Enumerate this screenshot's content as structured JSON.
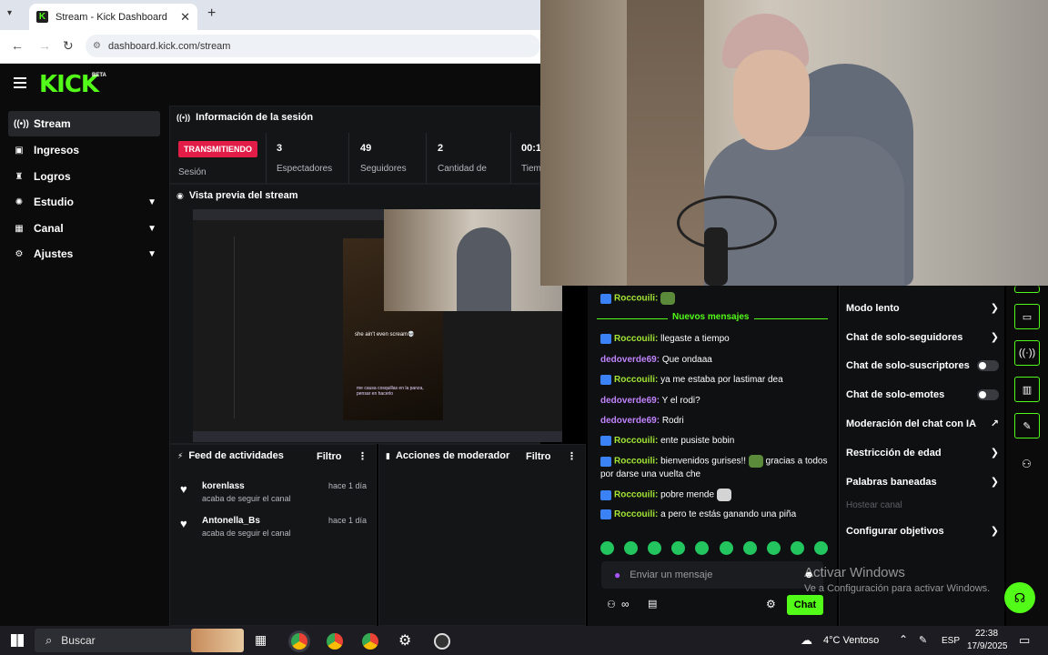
{
  "browser": {
    "tab_title": "Stream - Kick Dashboard",
    "url": "dashboard.kick.com/stream"
  },
  "brand": {
    "logo": "KICK",
    "beta": "BETA",
    "accent": "#53fc18"
  },
  "sidebar": {
    "items": [
      {
        "label": "Stream",
        "icon": "broadcast-icon",
        "active": true
      },
      {
        "label": "Ingresos",
        "icon": "wallet-icon"
      },
      {
        "label": "Logros",
        "icon": "trophy-icon"
      },
      {
        "label": "Estudio",
        "icon": "studio-icon"
      },
      {
        "label": "Canal",
        "icon": "channel-icon"
      },
      {
        "label": "Ajustes",
        "icon": "gear-icon"
      }
    ]
  },
  "session": {
    "title": "Información de la sesión",
    "live_badge": "TRANSMITIENDO",
    "status_label": "Sesión",
    "stats": [
      {
        "value": "3",
        "label": "Espectadores"
      },
      {
        "value": "49",
        "label": "Seguidores"
      },
      {
        "value": "2",
        "label": "Cantidad de"
      },
      {
        "value": "00:1",
        "label": "Tiem"
      }
    ]
  },
  "preview": {
    "title": "Vista previa del stream",
    "caption": "she ain't even scream💀",
    "caption2": "me causa cosquillas en la panza, pensar en hacerlo"
  },
  "activity": {
    "title": "Feed de actividades",
    "filter": "Filtro",
    "items": [
      {
        "name": "korenlass",
        "sub": "acaba de seguir el canal",
        "time": "hace 1 día"
      },
      {
        "name": "Antonella_Bs",
        "sub": "acaba de seguir el canal",
        "time": "hace 1 día"
      }
    ]
  },
  "moderator": {
    "title": "Acciones de moderador",
    "filter": "Filtro"
  },
  "chat": {
    "new_messages": "Nuevos mensajes",
    "messages": [
      {
        "user": "Roccouili:",
        "text": "",
        "kind": "rocco"
      },
      {
        "user": "Roccouili:",
        "text": "llegaste a tiempo",
        "kind": "rocco"
      },
      {
        "user": "dedoverde69:",
        "text": "Que ondaaa",
        "kind": "dedo"
      },
      {
        "user": "Roccouili:",
        "text": "ya me estaba por lastimar dea",
        "kind": "rocco"
      },
      {
        "user": "dedoverde69:",
        "text": "Y el rodi?",
        "kind": "dedo"
      },
      {
        "user": "dedoverde69:",
        "text": "Rodri",
        "kind": "dedo"
      },
      {
        "user": "Roccouili:",
        "text": "ente pusiste bobin",
        "kind": "rocco"
      },
      {
        "user": "Roccouili:",
        "text": "bienvenidos gurises!!",
        "text2": "gracias a todos por darse una vuelta che",
        "kind": "rocco"
      },
      {
        "user": "Roccouili:",
        "text": "pobre mende",
        "kind": "rocco"
      },
      {
        "user": "Roccouili:",
        "text": "a pero te estás ganando una piña",
        "kind": "rocco"
      }
    ],
    "input_placeholder": "Enviar un mensaje",
    "send_label": "Chat"
  },
  "settings": {
    "items": [
      {
        "label": "Modo lento",
        "control": "arrow"
      },
      {
        "label": "Chat de solo-seguidores",
        "control": "arrow"
      },
      {
        "label": "Chat de solo-suscriptores",
        "control": "toggle"
      },
      {
        "label": "Chat de solo-emotes",
        "control": "toggle"
      },
      {
        "label": "Moderación del chat con IA",
        "control": "external"
      },
      {
        "label": "Restricción de edad",
        "control": "arrow"
      },
      {
        "label": "Palabras baneadas",
        "control": "arrow"
      },
      {
        "label": "Hostear canal",
        "control": "disabled"
      },
      {
        "label": "Configurar objetivos",
        "control": "arrow"
      }
    ]
  },
  "watermark": {
    "line1": "Activar Windows",
    "line2": "Ve a Configuración para activar Windows."
  },
  "taskbar": {
    "search": "Buscar",
    "weather": "4°C Ventoso",
    "lang": "ESP",
    "time": "22:38",
    "date": "17/9/2025"
  }
}
